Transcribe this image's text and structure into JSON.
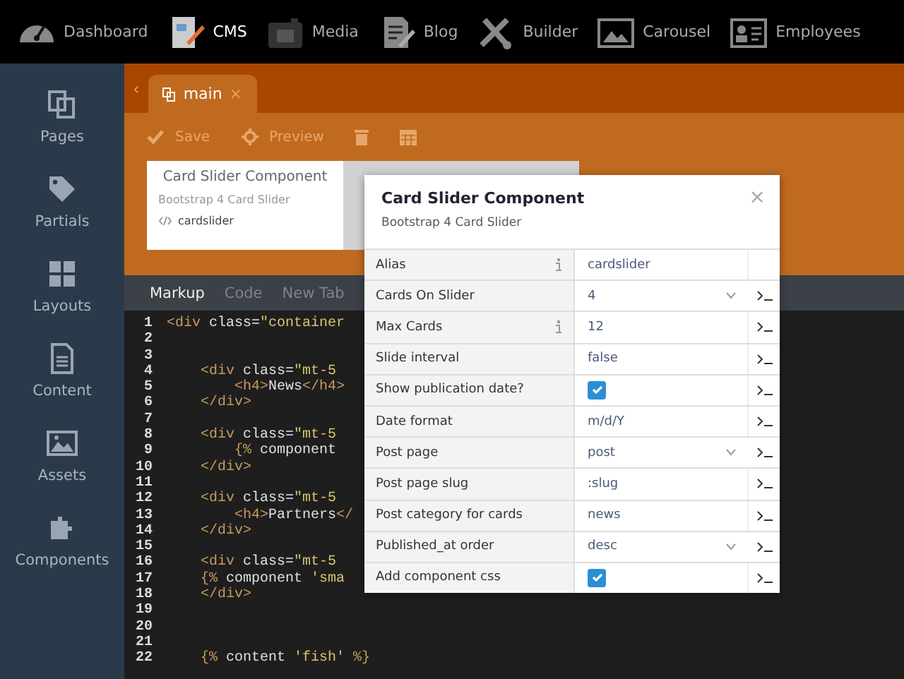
{
  "topnav": [
    {
      "label": "Dashboard",
      "selected": false
    },
    {
      "label": "CMS",
      "selected": true
    },
    {
      "label": "Media",
      "selected": false
    },
    {
      "label": "Blog",
      "selected": false
    },
    {
      "label": "Builder",
      "selected": false
    },
    {
      "label": "Carousel",
      "selected": false
    },
    {
      "label": "Employees",
      "selected": false
    }
  ],
  "sidebar": {
    "items": [
      {
        "label": "Pages"
      },
      {
        "label": "Partials"
      },
      {
        "label": "Layouts"
      },
      {
        "label": "Content"
      },
      {
        "label": "Assets"
      },
      {
        "label": "Components"
      }
    ]
  },
  "document_tab": {
    "scroll_left": "‹",
    "label": "main",
    "close": "×"
  },
  "toolbar": [
    {
      "kind": "save",
      "label": "Save"
    },
    {
      "kind": "preview",
      "label": "Preview"
    },
    {
      "kind": "trash"
    },
    {
      "kind": "calendar"
    }
  ],
  "component_card": {
    "title": "Card Slider Component",
    "description": "Bootstrap 4 Card Slider",
    "alias": "cardslider"
  },
  "editor": {
    "tabs": [
      {
        "label": "Markup",
        "selected": true
      },
      {
        "label": "Code",
        "selected": false
      },
      {
        "label": "New Tab",
        "selected": false
      }
    ],
    "lines": [
      {
        "number": "1",
        "tokens": [
          {
            "kind": "tag",
            "text": "<div "
          },
          {
            "kind": "attr",
            "text": "class="
          },
          {
            "kind": "string",
            "text": "\"container"
          }
        ]
      },
      {
        "number": "2"
      },
      {
        "number": "3"
      },
      {
        "number": "4",
        "tokens": [
          {
            "kind": "tag",
            "text": "    <div "
          },
          {
            "kind": "attr",
            "text": "class="
          },
          {
            "kind": "string",
            "text": "\"mt-5"
          }
        ]
      },
      {
        "number": "5",
        "tokens": [
          {
            "kind": "tag",
            "text": "        <h4>"
          },
          {
            "kind": "plain",
            "text": "News"
          },
          {
            "kind": "tag",
            "text": "</h4>"
          }
        ]
      },
      {
        "number": "6",
        "tokens": [
          {
            "kind": "tag",
            "text": "    </div>"
          }
        ]
      },
      {
        "number": "7"
      },
      {
        "number": "8",
        "tokens": [
          {
            "kind": "tag",
            "text": "    <div "
          },
          {
            "kind": "attr",
            "text": "class="
          },
          {
            "kind": "string",
            "text": "\"mt-5"
          }
        ]
      },
      {
        "number": "9",
        "tokens": [
          {
            "kind": "tag",
            "text": "        {% "
          },
          {
            "kind": "plain",
            "text": "component"
          }
        ]
      },
      {
        "number": "10",
        "tokens": [
          {
            "kind": "tag",
            "text": "    </div>"
          }
        ]
      },
      {
        "number": "11"
      },
      {
        "number": "12",
        "tokens": [
          {
            "kind": "tag",
            "text": "    <div "
          },
          {
            "kind": "attr",
            "text": "class="
          },
          {
            "kind": "string",
            "text": "\"mt-5"
          }
        ]
      },
      {
        "number": "13",
        "tokens": [
          {
            "kind": "tag",
            "text": "        <h4>"
          },
          {
            "kind": "plain",
            "text": "Partners"
          },
          {
            "kind": "tag",
            "text": "</"
          }
        ]
      },
      {
        "number": "14",
        "tokens": [
          {
            "kind": "tag",
            "text": "    </div>"
          }
        ]
      },
      {
        "number": "15"
      },
      {
        "number": "16",
        "tokens": [
          {
            "kind": "tag",
            "text": "    <div "
          },
          {
            "kind": "attr",
            "text": "class="
          },
          {
            "kind": "string",
            "text": "\"mt-5"
          }
        ]
      },
      {
        "number": "17",
        "tokens": [
          {
            "kind": "tag",
            "text": "    {% "
          },
          {
            "kind": "plain",
            "text": "component "
          },
          {
            "kind": "string",
            "text": "'sma"
          }
        ]
      },
      {
        "number": "18",
        "tokens": [
          {
            "kind": "tag",
            "text": "    </div>"
          }
        ]
      },
      {
        "number": "19"
      },
      {
        "number": "20"
      },
      {
        "number": "21"
      },
      {
        "number": "22",
        "tokens": [
          {
            "kind": "tag",
            "text": "    {% "
          },
          {
            "kind": "plain",
            "text": "content "
          },
          {
            "kind": "string",
            "text": "'fish'"
          },
          {
            "kind": "tag",
            "text": " %}"
          }
        ]
      }
    ]
  },
  "inspector": {
    "title": "Card Slider Component",
    "description": "Bootstrap 4 Card Slider",
    "close": "×",
    "rows": [
      {
        "label": "Alias",
        "info": true,
        "kind": "input",
        "value": "cardslider"
      },
      {
        "label": "Cards On Slider",
        "info": false,
        "kind": "select",
        "value": "4"
      },
      {
        "label": "Max Cards",
        "info": true,
        "kind": "text",
        "value": "12"
      },
      {
        "label": "Slide interval",
        "info": false,
        "kind": "text",
        "value": "false"
      },
      {
        "label": "Show publication date?",
        "info": false,
        "kind": "checkbox",
        "checked": true
      },
      {
        "label": "Date format",
        "info": false,
        "kind": "text",
        "value": "m/d/Y"
      },
      {
        "label": "Post page",
        "info": false,
        "kind": "select",
        "value": "post"
      },
      {
        "label": "Post page slug",
        "info": false,
        "kind": "text",
        "value": ":slug"
      },
      {
        "label": "Post category for cards",
        "info": false,
        "kind": "text",
        "value": "news"
      },
      {
        "label": "Published_at order",
        "info": false,
        "kind": "select",
        "value": "desc"
      },
      {
        "label": "Add component css",
        "info": false,
        "kind": "checkbox",
        "checked": true
      }
    ]
  }
}
